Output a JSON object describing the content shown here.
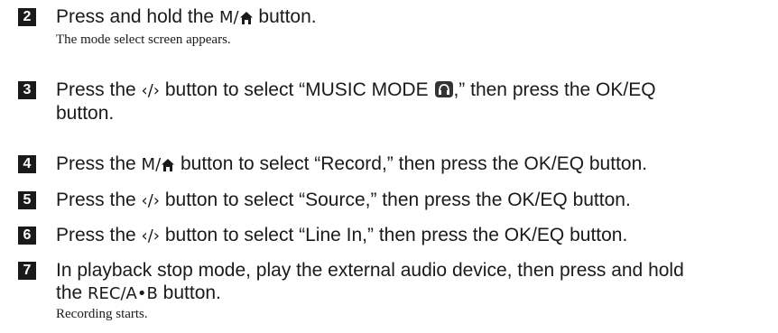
{
  "steps": [
    {
      "num": "2",
      "parts": {
        "a": "Press and hold the ",
        "btn": "M/",
        "b": " button."
      },
      "sub": "The mode select screen appears."
    },
    {
      "num": "3",
      "parts": {
        "a": "Press the ",
        "btn": "‹/›",
        "b": " button to select “MUSIC MODE ",
        "c": ",” then press the OK/EQ",
        "d": "button."
      }
    },
    {
      "num": "4",
      "parts": {
        "a": "Press the ",
        "btn": "M/",
        "b": " button to select “Record,” then press the OK/EQ button."
      }
    },
    {
      "num": "5",
      "parts": {
        "a": "Press the ",
        "btn": "‹/›",
        "b": " button to select “Source,” then press the OK/EQ button."
      }
    },
    {
      "num": "6",
      "parts": {
        "a": "Press the ",
        "btn": "‹/›",
        "b": " button to select “Line In,” then press the OK/EQ button."
      }
    },
    {
      "num": "7",
      "parts": {
        "a": "In playback stop mode, play the external audio device, then press and hold",
        "b": "the ",
        "btn": "REC/A•B",
        "c": " button."
      },
      "sub": "Recording starts."
    }
  ],
  "icons": {
    "home": "home-icon",
    "music_mode": "headphones-icon"
  }
}
